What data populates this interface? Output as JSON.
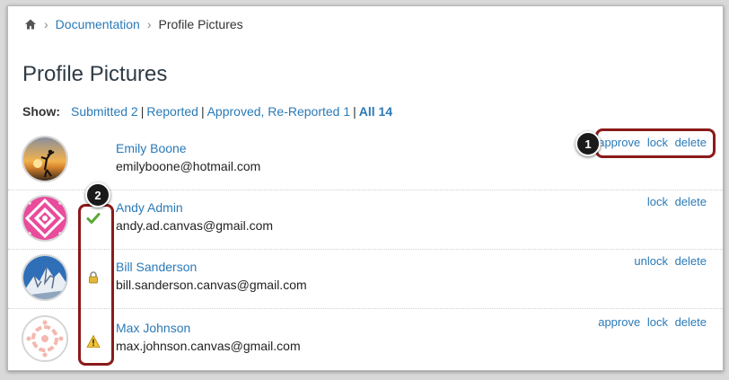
{
  "breadcrumb": {
    "home_icon": "home-icon",
    "items": [
      {
        "label": "Documentation"
      },
      {
        "label": "Profile Pictures"
      }
    ]
  },
  "page": {
    "title": "Profile Pictures"
  },
  "filter": {
    "show_label": "Show:",
    "options": [
      {
        "label": "Submitted 2"
      },
      {
        "label": "Reported"
      },
      {
        "label": "Approved, Re-Reported 1"
      },
      {
        "label": "All 14"
      }
    ],
    "selected": "All 14"
  },
  "users": [
    {
      "name": "Emily Boone",
      "email": "emilyboone@hotmail.com",
      "status_icon": "",
      "actions": [
        "approve",
        "lock",
        "delete"
      ]
    },
    {
      "name": "Andy Admin",
      "email": "andy.ad.canvas@gmail.com",
      "status_icon": "checkmark-icon",
      "actions": [
        "lock",
        "delete"
      ]
    },
    {
      "name": "Bill Sanderson",
      "email": "bill.sanderson.canvas@gmail.com",
      "status_icon": "lock-icon",
      "actions": [
        "unlock",
        "delete"
      ]
    },
    {
      "name": "Max Johnson",
      "email": "max.johnson.canvas@gmail.com",
      "status_icon": "warning-icon",
      "actions": [
        "approve",
        "lock",
        "delete"
      ]
    }
  ],
  "callouts": [
    {
      "number": "1"
    },
    {
      "number": "2"
    }
  ],
  "colors": {
    "link": "#2a7ab8",
    "callout": "#8b1a1a",
    "check": "#5aa832",
    "warning": "#f3c431"
  }
}
